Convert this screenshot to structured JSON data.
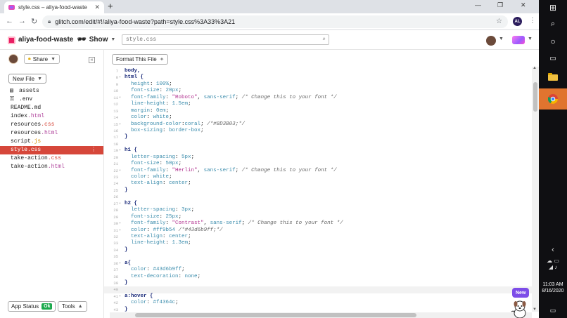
{
  "browser": {
    "tab_title": "style.css – aliya-food-waste",
    "tab_close": "✕",
    "new_tab": "+",
    "window_controls": [
      "—",
      "❐",
      "✕"
    ],
    "nav": {
      "back": "←",
      "forward": "→",
      "reload": "↻"
    },
    "url": "glitch.com/edit/#!/aliya-food-waste?path=style.css%3A33%3A21",
    "profile_initials": "AL",
    "colors": {
      "tabstrip": "#dee1e6"
    }
  },
  "glitch": {
    "project_name": "aliya-food-waste",
    "show_label": "Show",
    "search_placeholder": "style.css",
    "share_label": "Share",
    "collapse_label": "«",
    "new_file_label": "New File",
    "format_label": "Format This File",
    "app_status_label": "App Status",
    "status_ok": "Ok",
    "tools_label": "Tools",
    "new_badge": "New",
    "colors": {
      "selected_file": "#d6473a",
      "ok_badge": "#1ba94c",
      "new_badge": "#7d4de8"
    }
  },
  "files": [
    {
      "name": "assets",
      "ext": "",
      "icon": "assets-icon"
    },
    {
      "name": "",
      "ext": ".env",
      "icon": "key-icon"
    },
    {
      "name": "README",
      "ext": ".md",
      "icon": ""
    },
    {
      "name": "index",
      "ext": ".html",
      "icon": ""
    },
    {
      "name": "resources",
      "ext": ".css",
      "icon": ""
    },
    {
      "name": "resources",
      "ext": ".html",
      "icon": ""
    },
    {
      "name": "script",
      "ext": ".js",
      "icon": ""
    },
    {
      "name": "style",
      "ext": ".css",
      "icon": "",
      "selected": true
    },
    {
      "name": "take-action",
      "ext": ".css",
      "icon": ""
    },
    {
      "name": "take-action",
      "ext": ".html",
      "icon": ""
    }
  ],
  "code_lines": [
    {
      "n": "7",
      "fold": "",
      "tokens": [
        [
          "sel",
          "body,"
        ]
      ]
    },
    {
      "n": "8",
      "fold": "▾",
      "tokens": [
        [
          "sel",
          "html {"
        ]
      ]
    },
    {
      "n": "9",
      "fold": "",
      "tokens": [
        [
          "plain",
          "  "
        ],
        [
          "prop",
          "height"
        ],
        [
          "plain",
          ": "
        ],
        [
          "num",
          "100%"
        ],
        [
          "plain",
          ";"
        ]
      ]
    },
    {
      "n": "10",
      "fold": "",
      "tokens": [
        [
          "plain",
          "  "
        ],
        [
          "prop",
          "font-size"
        ],
        [
          "plain",
          ": "
        ],
        [
          "num",
          "20px"
        ],
        [
          "plain",
          ";"
        ]
      ]
    },
    {
      "n": "11",
      "fold": "▾",
      "tokens": [
        [
          "plain",
          "  "
        ],
        [
          "prop",
          "font-family"
        ],
        [
          "plain",
          ": "
        ],
        [
          "str",
          "\"Roboto\""
        ],
        [
          "plain",
          ", "
        ],
        [
          "kw",
          "sans-serif"
        ],
        [
          "plain",
          "; "
        ],
        [
          "com",
          "/* Change this to your font */"
        ]
      ]
    },
    {
      "n": "12",
      "fold": "",
      "tokens": [
        [
          "plain",
          "  "
        ],
        [
          "prop",
          "line-height"
        ],
        [
          "plain",
          ": "
        ],
        [
          "num",
          "1.5em"
        ],
        [
          "plain",
          ";"
        ]
      ]
    },
    {
      "n": "13",
      "fold": "",
      "tokens": [
        [
          "plain",
          "  "
        ],
        [
          "prop",
          "margin"
        ],
        [
          "plain",
          ": "
        ],
        [
          "num",
          "0em"
        ],
        [
          "plain",
          ";"
        ]
      ]
    },
    {
      "n": "14",
      "fold": "",
      "tokens": [
        [
          "plain",
          "  "
        ],
        [
          "prop",
          "color"
        ],
        [
          "plain",
          ": "
        ],
        [
          "kw",
          "white"
        ],
        [
          "plain",
          ";"
        ]
      ]
    },
    {
      "n": "15",
      "fold": "▾",
      "tokens": [
        [
          "plain",
          "  "
        ],
        [
          "prop",
          "background-color"
        ],
        [
          "plain",
          ":"
        ],
        [
          "kw",
          "coral"
        ],
        [
          "plain",
          "; "
        ],
        [
          "com",
          "/*#8D3B03;*/"
        ]
      ]
    },
    {
      "n": "16",
      "fold": "",
      "tokens": [
        [
          "plain",
          "  "
        ],
        [
          "prop",
          "box-sizing"
        ],
        [
          "plain",
          ": "
        ],
        [
          "kw",
          "border-box"
        ],
        [
          "plain",
          ";"
        ]
      ]
    },
    {
      "n": "17",
      "fold": "",
      "tokens": [
        [
          "sel",
          "}"
        ]
      ]
    },
    {
      "n": "18",
      "fold": "",
      "tokens": []
    },
    {
      "n": "19",
      "fold": "▾",
      "tokens": [
        [
          "sel",
          "h1 {"
        ]
      ]
    },
    {
      "n": "20",
      "fold": "",
      "tokens": [
        [
          "plain",
          "  "
        ],
        [
          "prop",
          "letter-spacing"
        ],
        [
          "plain",
          ": "
        ],
        [
          "num",
          "5px"
        ],
        [
          "plain",
          ";"
        ]
      ]
    },
    {
      "n": "21",
      "fold": "",
      "tokens": [
        [
          "plain",
          "  "
        ],
        [
          "prop",
          "font-size"
        ],
        [
          "plain",
          ": "
        ],
        [
          "num",
          "50px"
        ],
        [
          "plain",
          ";"
        ]
      ]
    },
    {
      "n": "22",
      "fold": "▾",
      "tokens": [
        [
          "plain",
          "  "
        ],
        [
          "prop",
          "font-family"
        ],
        [
          "plain",
          ": "
        ],
        [
          "str",
          "\"Herlin\""
        ],
        [
          "plain",
          ", "
        ],
        [
          "kw",
          "sans-serif"
        ],
        [
          "plain",
          "; "
        ],
        [
          "com",
          "/* Change this to your font */"
        ]
      ]
    },
    {
      "n": "23",
      "fold": "",
      "tokens": [
        [
          "plain",
          "  "
        ],
        [
          "prop",
          "color"
        ],
        [
          "plain",
          ": "
        ],
        [
          "kw",
          "white"
        ],
        [
          "plain",
          ";"
        ]
      ]
    },
    {
      "n": "24",
      "fold": "",
      "tokens": [
        [
          "plain",
          "  "
        ],
        [
          "prop",
          "text-align"
        ],
        [
          "plain",
          ": "
        ],
        [
          "kw",
          "center"
        ],
        [
          "plain",
          ";"
        ]
      ]
    },
    {
      "n": "25",
      "fold": "",
      "tokens": [
        [
          "sel",
          "}"
        ]
      ]
    },
    {
      "n": "26",
      "fold": "",
      "tokens": []
    },
    {
      "n": "27",
      "fold": "▾",
      "tokens": [
        [
          "sel",
          "h2 {"
        ]
      ]
    },
    {
      "n": "28",
      "fold": "",
      "tokens": [
        [
          "plain",
          "  "
        ],
        [
          "prop",
          "letter-spacing"
        ],
        [
          "plain",
          ": "
        ],
        [
          "num",
          "3px"
        ],
        [
          "plain",
          ";"
        ]
      ]
    },
    {
      "n": "29",
      "fold": "",
      "tokens": [
        [
          "plain",
          "  "
        ],
        [
          "prop",
          "font-size"
        ],
        [
          "plain",
          ": "
        ],
        [
          "num",
          "25px"
        ],
        [
          "plain",
          ";"
        ]
      ]
    },
    {
      "n": "30",
      "fold": "▾",
      "tokens": [
        [
          "plain",
          "  "
        ],
        [
          "prop",
          "font-family"
        ],
        [
          "plain",
          ": "
        ],
        [
          "str",
          "\"Contrast\""
        ],
        [
          "plain",
          ", "
        ],
        [
          "kw",
          "sans-serif"
        ],
        [
          "plain",
          "; "
        ],
        [
          "com",
          "/* Change this to your font */"
        ]
      ]
    },
    {
      "n": "31",
      "fold": "▾",
      "tokens": [
        [
          "plain",
          "  "
        ],
        [
          "prop",
          "color"
        ],
        [
          "plain",
          ": "
        ],
        [
          "num",
          "#ff9b54"
        ],
        [
          "plain",
          " "
        ],
        [
          "com",
          "/*#43d6b9ff;*/"
        ]
      ]
    },
    {
      "n": "32",
      "fold": "",
      "tokens": [
        [
          "plain",
          "  "
        ],
        [
          "prop",
          "text-align"
        ],
        [
          "plain",
          ": "
        ],
        [
          "kw",
          "center"
        ],
        [
          "plain",
          ";"
        ]
      ]
    },
    {
      "n": "33",
      "fold": "",
      "tokens": [
        [
          "plain",
          "  "
        ],
        [
          "prop",
          "line-height"
        ],
        [
          "plain",
          ": "
        ],
        [
          "num",
          "1.3em"
        ],
        [
          "plain",
          ";"
        ]
      ]
    },
    {
      "n": "34",
      "fold": "",
      "tokens": [
        [
          "sel",
          "}"
        ]
      ]
    },
    {
      "n": "35",
      "fold": "",
      "tokens": []
    },
    {
      "n": "36",
      "fold": "▾",
      "tokens": [
        [
          "sel",
          "a{"
        ]
      ]
    },
    {
      "n": "37",
      "fold": "",
      "tokens": [
        [
          "plain",
          "  "
        ],
        [
          "prop",
          "color"
        ],
        [
          "plain",
          ": "
        ],
        [
          "num",
          "#43d6b9ff"
        ],
        [
          "plain",
          ";"
        ]
      ]
    },
    {
      "n": "38",
      "fold": "",
      "tokens": [
        [
          "plain",
          "  "
        ],
        [
          "prop",
          "text-decoration"
        ],
        [
          "plain",
          ": "
        ],
        [
          "kw",
          "none"
        ],
        [
          "plain",
          ";"
        ]
      ]
    },
    {
      "n": "39",
      "fold": "",
      "tokens": [
        [
          "sel",
          "}"
        ]
      ]
    },
    {
      "n": "40",
      "fold": "",
      "tokens": [],
      "hl": true
    },
    {
      "n": "41",
      "fold": "▾",
      "tokens": [
        [
          "sel",
          "a:hover {"
        ]
      ]
    },
    {
      "n": "42",
      "fold": "",
      "tokens": [
        [
          "plain",
          "  "
        ],
        [
          "prop",
          "color"
        ],
        [
          "plain",
          ": "
        ],
        [
          "num",
          "#f4364c"
        ],
        [
          "plain",
          ";"
        ]
      ]
    },
    {
      "n": "43",
      "fold": "",
      "tokens": [
        [
          "sel",
          "}"
        ]
      ]
    },
    {
      "n": "44",
      "fold": "",
      "tokens": []
    }
  ],
  "taskbar": {
    "clock_time": "11:03 AM",
    "clock_date": "8/16/2020",
    "colors": {
      "chrome_active": "#e0742f"
    }
  }
}
